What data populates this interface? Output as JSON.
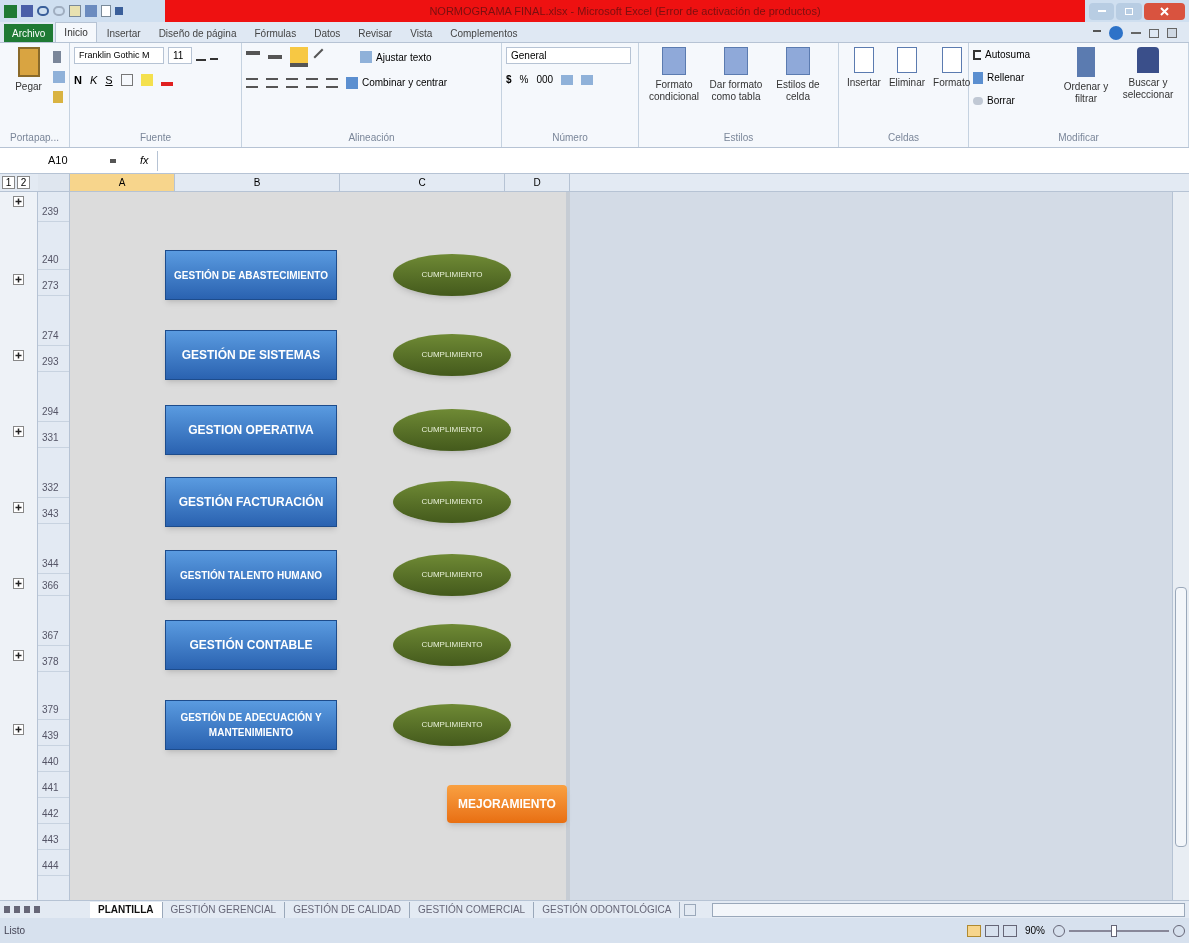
{
  "title_bar": {
    "title": "NORMOGRAMA FINAL.xlsx - Microsoft Excel (Error de activación de productos)"
  },
  "menu_tabs": [
    {
      "label": "Archivo",
      "kind": "file",
      "selected": false
    },
    {
      "label": "Inicio",
      "kind": "tab",
      "selected": true
    },
    {
      "label": "Insertar",
      "kind": "tab",
      "selected": false
    },
    {
      "label": "Diseño de página",
      "kind": "tab",
      "selected": false
    },
    {
      "label": "Fórmulas",
      "kind": "tab",
      "selected": false
    },
    {
      "label": "Datos",
      "kind": "tab",
      "selected": false
    },
    {
      "label": "Revisar",
      "kind": "tab",
      "selected": false
    },
    {
      "label": "Vista",
      "kind": "tab",
      "selected": false
    },
    {
      "label": "Complementos",
      "kind": "tab",
      "selected": false
    }
  ],
  "ribbon": {
    "clipboard": {
      "label": "Portapap...",
      "paste": "Pegar"
    },
    "font": {
      "label": "Fuente",
      "font_name": "Franklin Gothic M",
      "font_size": "11",
      "bold": "N",
      "italic": "K",
      "underline": "S"
    },
    "alignment": {
      "label": "Alineación",
      "wrap_text": "Ajustar texto",
      "merge_center": "Combinar y centrar"
    },
    "number": {
      "label": "Número",
      "format": "General",
      "currency": "$",
      "percent": "%",
      "thousands": "000"
    },
    "styles": {
      "label": "Estilos",
      "items": [
        "Formato condicional",
        "Dar formato como tabla",
        "Estilos de celda"
      ]
    },
    "cells": {
      "label": "Celdas",
      "items": [
        "Insertar",
        "Eliminar",
        "Formato"
      ]
    },
    "editing": {
      "label": "Modificar",
      "autosum": "Autosuma",
      "fill": "Rellenar",
      "clear": "Borrar",
      "sort": "Ordenar y filtrar",
      "find": "Buscar y seleccionar"
    }
  },
  "formula_bar": {
    "name_box": "A10",
    "fx": "fx"
  },
  "outline_levels": [
    "1",
    "2"
  ],
  "columns": [
    {
      "label": "A",
      "selected": true
    },
    {
      "label": "B",
      "selected": false
    },
    {
      "label": "C",
      "selected": false
    },
    {
      "label": "D",
      "selected": false
    }
  ],
  "rows": [
    {
      "number": "239",
      "collapsed": true
    },
    {
      "number": "240",
      "collapsed": false
    },
    {
      "number": "273",
      "collapsed": true
    },
    {
      "number": "274",
      "collapsed": false
    },
    {
      "number": "293",
      "collapsed": true
    },
    {
      "number": "294",
      "collapsed": false
    },
    {
      "number": "331",
      "collapsed": true
    },
    {
      "number": "332",
      "collapsed": false
    },
    {
      "number": "343",
      "collapsed": true
    },
    {
      "number": "344",
      "collapsed": false
    },
    {
      "number": "366",
      "collapsed": true
    },
    {
      "number": "367",
      "collapsed": false
    },
    {
      "number": "378",
      "collapsed": true
    },
    {
      "number": "379",
      "collapsed": false
    },
    {
      "number": "439",
      "collapsed": true
    },
    {
      "number": "440",
      "collapsed": false
    },
    {
      "number": "441",
      "collapsed": false
    },
    {
      "number": "442",
      "collapsed": false
    },
    {
      "number": "443",
      "collapsed": false
    },
    {
      "number": "444",
      "collapsed": false
    }
  ],
  "processes": [
    {
      "label": "GESTIÓN DE ABASTECIMIENTO",
      "status": "CUMPLIMIENTO"
    },
    {
      "label": "GESTIÓN DE SISTEMAS",
      "status": "CUMPLIMIENTO"
    },
    {
      "label": "GESTION OPERATIVA",
      "status": "CUMPLIMIENTO"
    },
    {
      "label": "GESTIÓN FACTURACIÓN",
      "status": "CUMPLIMIENTO"
    },
    {
      "label": "GESTIÓN TALENTO HUMANO",
      "status": "CUMPLIMIENTO"
    },
    {
      "label": "GESTIÓN CONTABLE",
      "status": "CUMPLIMIENTO"
    },
    {
      "label": "GESTIÓN DE ADECUACIÓN Y MANTENIMIENTO",
      "status": "CUMPLIMIENTO"
    }
  ],
  "improvement_button": "MEJORAMIENTO",
  "sheet_tabs": [
    {
      "label": "PLANTILLA",
      "selected": true
    },
    {
      "label": "GESTIÓN GERENCIAL",
      "selected": false
    },
    {
      "label": "GESTIÓN DE CALIDAD",
      "selected": false
    },
    {
      "label": "GESTIÓN COMERCIAL",
      "selected": false
    },
    {
      "label": "GESTIÓN ODONTOLÓGICA",
      "selected": false
    }
  ],
  "status_bar": {
    "status": "Listo",
    "zoom": "90%",
    "zoom_slider": {
      "level": 0.45
    }
  }
}
